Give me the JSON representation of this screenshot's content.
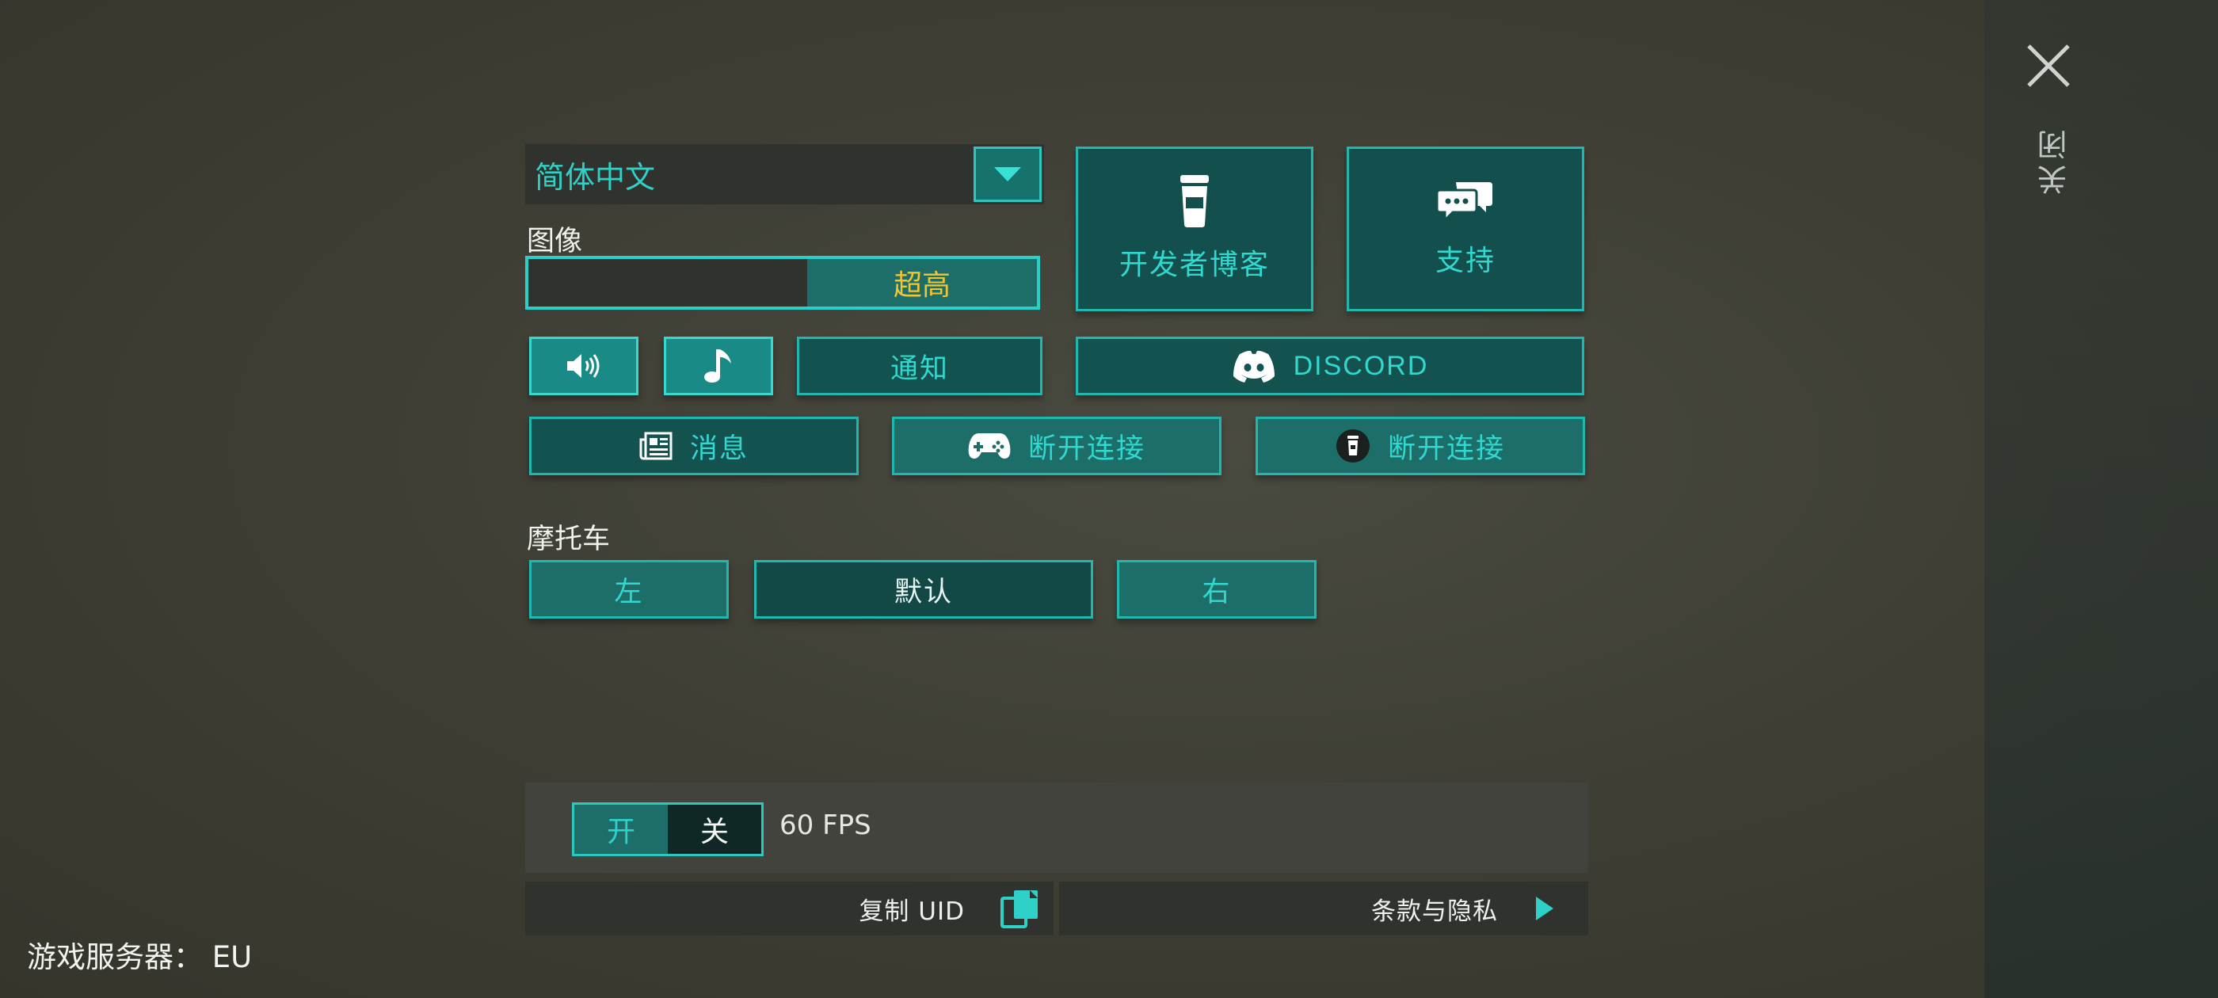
{
  "language": {
    "selected": "简体中文"
  },
  "graphics": {
    "label": "图像",
    "quality": "超高"
  },
  "tiles": {
    "dev_blog": "开发者博客",
    "support": "支持"
  },
  "row1": {
    "notify_label": "通知",
    "discord_label": "DISCORD"
  },
  "row2": {
    "news_label": "消息",
    "gamepad_disconnect": "断开连接",
    "wear_disconnect": "断开连接"
  },
  "moto": {
    "label": "摩托车",
    "left": "左",
    "default": "默认",
    "right": "右"
  },
  "fps": {
    "on_label": "开",
    "off_label": "关",
    "value_text": "60 FPS"
  },
  "bottom": {
    "copy_uid": "复制 UID",
    "terms": "条款与隐私"
  },
  "server_text": "游戏服务器： EU",
  "close_label": "关闭",
  "colors": {
    "accent": "#1fb7b0",
    "accent_text": "#31d8cf",
    "quality_text": "#f2c531"
  }
}
